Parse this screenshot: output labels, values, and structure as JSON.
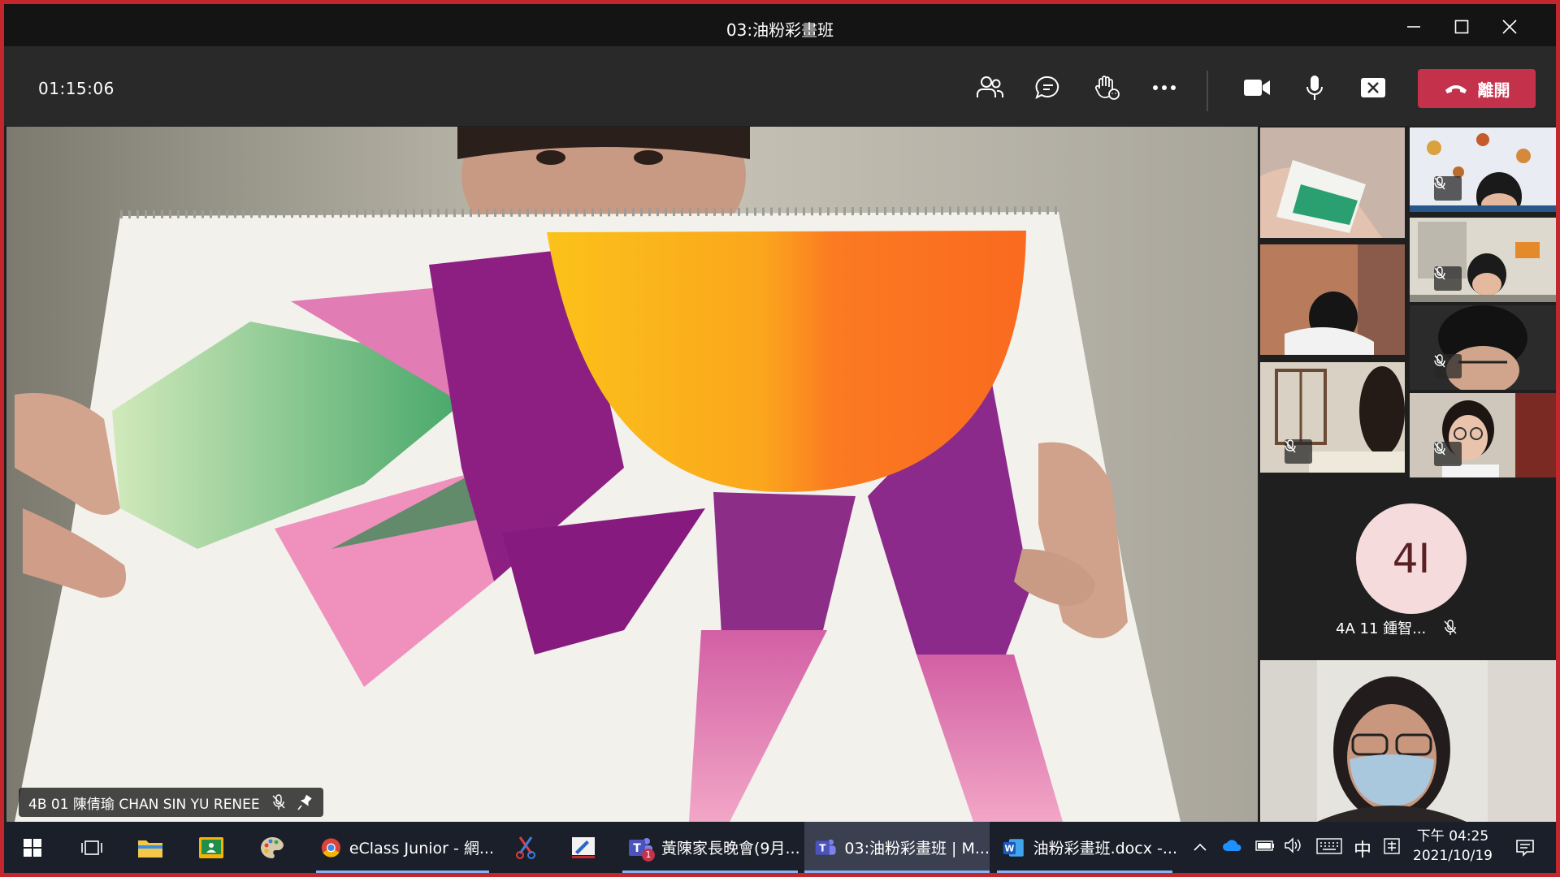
{
  "window": {
    "title": "03:油粉彩畫班"
  },
  "toolbar": {
    "timer": "01:15:06",
    "leave_label": "離開",
    "icons": [
      "participants-icon",
      "chat-icon",
      "reactions-icon",
      "more-icon",
      "camera-icon",
      "microphone-icon",
      "share-screen-icon",
      "phone-hangup-icon"
    ]
  },
  "stage": {
    "participant_name": "4B 01 陳倩瑜 CHAN SIN YU RENEE",
    "muted": true,
    "pinned": true
  },
  "gallery": {
    "avatar_initials": "4I",
    "avatar_name": "4A 11 鍾智...",
    "avatar_color": "#f5dbdc"
  },
  "taskbar": {
    "apps": [
      {
        "label": "eClass Junior - 網..."
      },
      {
        "label": "黃陳家長晚會(9月..."
      },
      {
        "label": "03:油粉彩畫班 | M..."
      },
      {
        "label": "油粉彩畫班.docx -..."
      }
    ],
    "teams_badge": "1",
    "ime_label": "中",
    "clock_time": "下午 04:25",
    "clock_date": "2021/10/19"
  },
  "colors": {
    "leave_button": "#c4314b",
    "window_frame": "#c4262e",
    "taskbar": "#1a1f2a"
  }
}
